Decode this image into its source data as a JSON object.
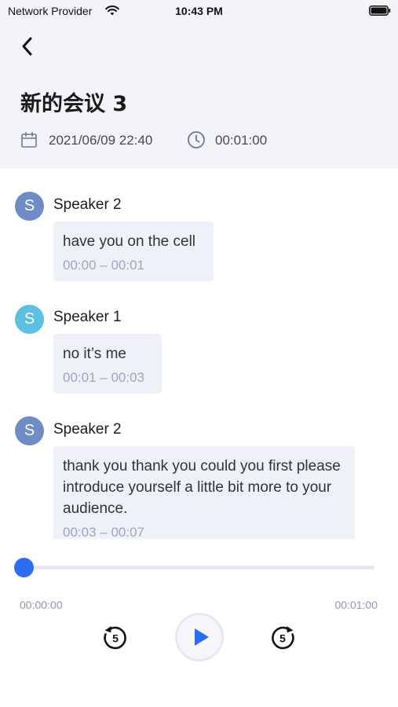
{
  "status_bar": {
    "carrier": "Network Provider",
    "time": "10:43 PM",
    "wifi_icon": "wifi-icon",
    "battery_icon": "battery-icon"
  },
  "header": {
    "back_icon": "chevron-left-icon",
    "title": "新的会议 3",
    "date": "2021/06/09 22:40",
    "duration": "00:01:00",
    "date_icon": "calendar-icon",
    "duration_icon": "clock-icon",
    "background_color": "#f3f4f8"
  },
  "transcript": {
    "entries": [
      {
        "avatar_letter": "S",
        "avatar_color": "#6f8cc4",
        "speaker": "Speaker 2",
        "text": "have you on the cell",
        "time_range": "00:00 – 00:01"
      },
      {
        "avatar_letter": "S",
        "avatar_color": "#5ec0e0",
        "speaker": "Speaker 1",
        "text": "no it’s me",
        "time_range": "00:01 – 00:03"
      },
      {
        "avatar_letter": "S",
        "avatar_color": "#6f8cc4",
        "speaker": "Speaker 2",
        "text": "thank you thank you could you first please introduce yourself a little bit more to your audience.",
        "time_range": "00:03 – 00:07"
      }
    ],
    "bubble_color": "#eef1f7"
  },
  "player": {
    "current_time": "00:00:00",
    "total_time": "00:01:00",
    "progress": 0,
    "rewind_label": "5",
    "forward_label": "5",
    "accent_color": "#2d6ef0",
    "rewind_icon": "rewind-5-icon",
    "play_icon": "play-icon",
    "forward_icon": "forward-5-icon"
  }
}
